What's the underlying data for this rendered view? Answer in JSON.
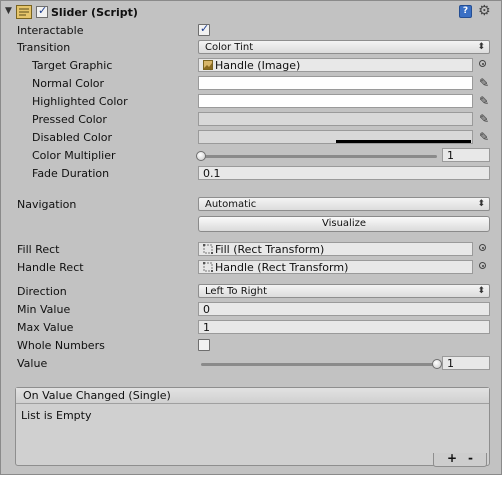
{
  "component": {
    "title": "Slider (Script)",
    "enabled": true,
    "help_icon": "help-book-icon",
    "gear_icon": "gear-icon"
  },
  "fields": {
    "interactable": {
      "label": "Interactable",
      "checked": true
    },
    "transition": {
      "label": "Transition",
      "value": "Color Tint"
    },
    "target_graphic": {
      "label": "Target Graphic",
      "value": "Handle (Image)"
    },
    "normal_color": {
      "label": "Normal Color",
      "color": "#ffffff"
    },
    "highlighted_color": {
      "label": "Highlighted Color",
      "color": "#ffffff"
    },
    "pressed_color": {
      "label": "Pressed Color",
      "color": "#d8d8d8"
    },
    "disabled_color": {
      "label": "Disabled Color",
      "color": "#d8d8d8"
    },
    "color_multiplier": {
      "label": "Color Multiplier",
      "value": "1",
      "fraction": 0
    },
    "fade_duration": {
      "label": "Fade Duration",
      "value": "0.1"
    },
    "navigation": {
      "label": "Navigation",
      "value": "Automatic"
    },
    "visualize": {
      "label": "Visualize"
    },
    "fill_rect": {
      "label": "Fill Rect",
      "value": "Fill (Rect Transform)"
    },
    "handle_rect": {
      "label": "Handle Rect",
      "value": "Handle (Rect Transform)"
    },
    "direction": {
      "label": "Direction",
      "value": "Left To Right"
    },
    "min_value": {
      "label": "Min Value",
      "value": "0"
    },
    "max_value": {
      "label": "Max Value",
      "value": "1"
    },
    "whole_numbers": {
      "label": "Whole Numbers",
      "checked": false
    },
    "value": {
      "label": "Value",
      "value": "1",
      "fraction": 1
    }
  },
  "event": {
    "title": "On Value Changed (Single)",
    "empty_text": "List is Empty",
    "add_label": "+",
    "remove_label": "-"
  },
  "icons": {
    "object_field": "target-circle-icon",
    "color_picker": "eyedropper-icon",
    "image_asset": "image-asset-icon",
    "rect_transform": "rect-transform-icon"
  }
}
